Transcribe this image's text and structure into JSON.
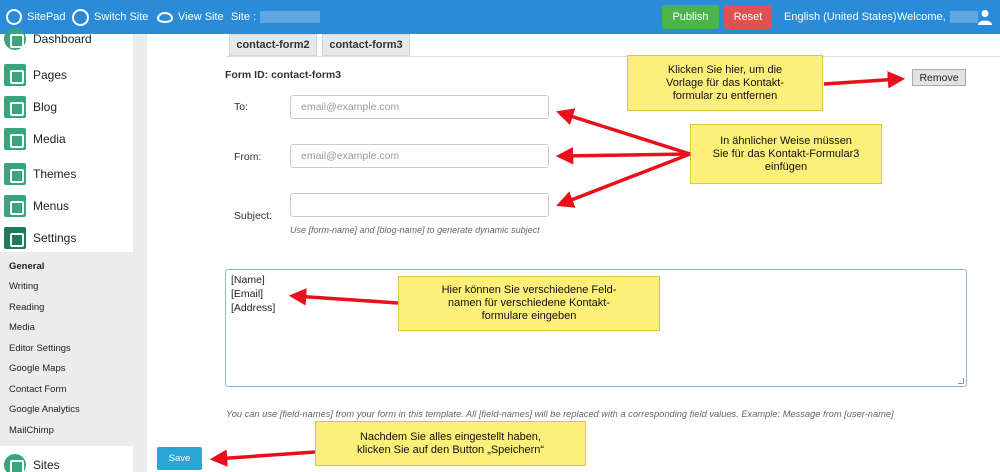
{
  "topbar": {
    "brand": "SitePad",
    "switch_site": "Switch Site",
    "view_site": "View Site",
    "site_label": "Site :",
    "publish": "Publish",
    "reset": "Reset",
    "language": "English (United States)",
    "welcome": "Welcome,",
    "icons": [
      "sitepad-logo-icon",
      "globe-icon",
      "eye-icon",
      "user-icon"
    ]
  },
  "sidebar": {
    "items": [
      {
        "label": "Dashboard",
        "icon": "dashboard-icon"
      },
      {
        "label": "Pages",
        "icon": "pages-icon"
      },
      {
        "label": "Blog",
        "icon": "blog-icon"
      },
      {
        "label": "Media",
        "icon": "media-icon"
      },
      {
        "label": "Themes",
        "icon": "paint-roller-icon"
      },
      {
        "label": "Menus",
        "icon": "menus-icon"
      },
      {
        "label": "Settings",
        "icon": "gear-icon"
      }
    ],
    "settings_sub": [
      "General",
      "Writing",
      "Reading",
      "Media",
      "Editor Settings",
      "Google Maps",
      "Contact Form",
      "Google Analytics",
      "MailChimp"
    ],
    "sites": "Sites"
  },
  "form": {
    "tabs": [
      "contact-form2",
      "contact-form3"
    ],
    "form_id": "Form ID: contact-form3",
    "remove": "Remove",
    "to_label": "To:",
    "to_placeholder": "email@example.com",
    "from_label": "From:",
    "from_placeholder": "email@example.com",
    "subject_label": "Subject:",
    "subject_value": "",
    "subject_hint": "Use [form-name] and [blog-name] to generate dynamic subject",
    "template_lines": [
      "[Name]",
      "[Email]",
      "[Address]"
    ],
    "template_hint": "You can use [field-names] from your form in this template. All [field-names] will be replaced with a corresponding field values. Example: Message from [user-name]",
    "save": "Save"
  },
  "callouts": {
    "remove": [
      "Klicken Sie hier, um die",
      "Vorlage für das Kontakt-",
      "formular zu entfernen"
    ],
    "fields": [
      "In ähnlicher Weise müssen",
      "Sie für das Kontakt-Formular3",
      "einfügen"
    ],
    "names": [
      "Hier können Sie verschiedene Feld-",
      "namen für verschiedene Kontakt-",
      "formulare eingeben"
    ],
    "save": [
      "Nachdem Sie alles eingestellt haben,",
      "klicken Sie auf den Button „Speichern“"
    ]
  },
  "colors": {
    "topbar": "#2a8cd8",
    "publish": "#4bb54b",
    "reset": "#e0524f",
    "sidebar_icon": "#3aa57a",
    "callout": "#fdf07a",
    "arrow": "#e8101a"
  }
}
